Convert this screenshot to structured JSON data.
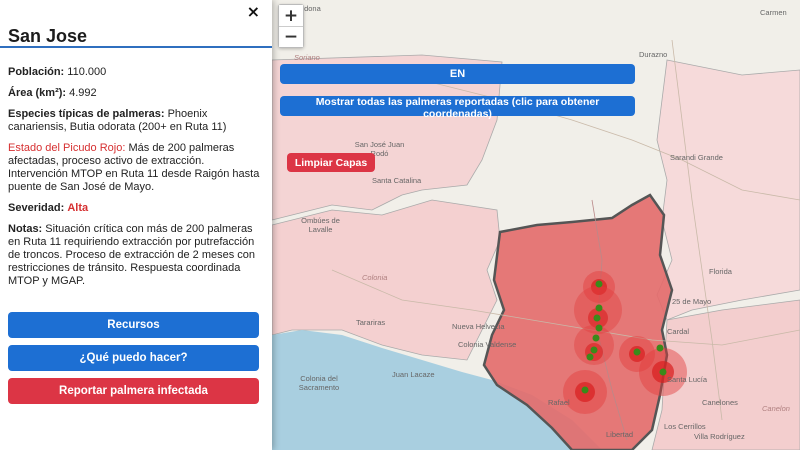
{
  "sidebar": {
    "close_symbol": "×",
    "title": "San Jose",
    "population_label": "Población:",
    "population_value": " 110.000",
    "area_label": "Área (km²):",
    "area_value": " 4.992",
    "species_label": "Especies típicas de palmeras:",
    "species_value": " Phoenix canariensis, Butia odorata (200+ en Ruta 11)",
    "status_label": "Estado del Picudo Rojo:",
    "status_value": " Más de 200 palmeras afectadas, proceso activo de extracción. Intervención MTOP en Ruta 11 desde Raigón hasta puente de San José de Mayo.",
    "severity_label": "Severidad:",
    "severity_value": "Alta",
    "notes_label": "Notas:",
    "notes_value": " Situación crítica con más de 200 palmeras en Ruta 11 requiriendo extracción por putrefacción de troncos. Proceso de extracción de 2 meses con restricciones de tránsito. Respuesta coordinada MTOP y MGAP.",
    "buttons": {
      "resources": "Recursos",
      "what_can_i_do": "¿Qué puedo hacer?",
      "report": "Reportar palmera infectada"
    }
  },
  "map": {
    "zoom_in": "+",
    "zoom_out": "−",
    "lang_button": "EN",
    "show_all_button": "Mostrar todas las palmeras reportadas (clic para obtener coordenadas)",
    "clear_button": "Limpiar Capas",
    "place_labels": [
      "Cardona",
      "Carmen",
      "Durazno",
      "Soriano",
      "San José Juan Rodó",
      "Sarandi Grande",
      "Santa Catalina",
      "Ombúes de Lavalle",
      "Colonia",
      "Florida",
      "25 de Mayo",
      "Tarariras",
      "Nueva Helvecia",
      "Colonia Valdense",
      "Juan Lacaze",
      "Colonia del Sacramento",
      "Rafael",
      "Libertad",
      "Canelones",
      "Los Cerrillos",
      "Villa Rodríguez",
      "Santa Lucía",
      "Cardal",
      "Canelon"
    ],
    "colors": {
      "blue_button": "#1d6fd3",
      "red_button": "#dc3545",
      "highlight_fill": "#e36a6a",
      "region_fill": "#f4d0d0",
      "water": "#a9cfe0"
    }
  }
}
